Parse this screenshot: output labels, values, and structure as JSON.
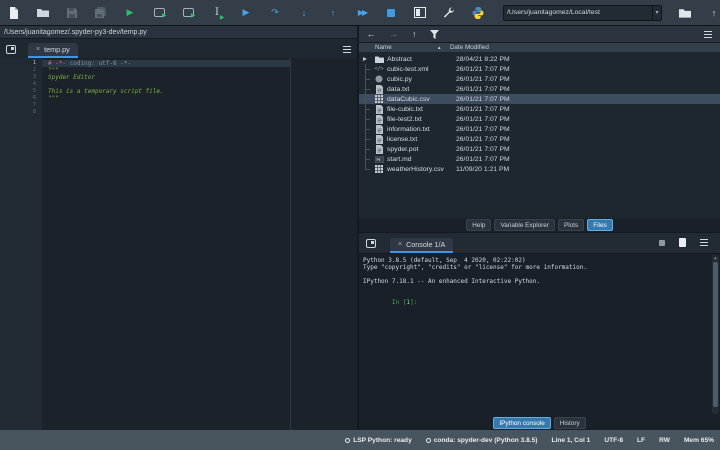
{
  "icons": {
    "run": "▶",
    "debug": "▶",
    "continue": "▶▶",
    "rerun": "↷",
    "step_into": "↓",
    "step_out": "↑",
    "back": "←",
    "forward": "→",
    "up": "↑",
    "up_dir": "↑",
    "sort_asc": "▲",
    "close": "×",
    "caret": "▾",
    "scroll_up": "▲",
    "mini_play": "▶"
  },
  "toolbar": {
    "file_actions": [
      "new-file",
      "open-file",
      "save",
      "save-all"
    ],
    "run_actions": [
      "run-file",
      "run-cell",
      "run-cell-advance",
      "run-selection"
    ],
    "debug_actions": [
      "debug-file",
      "rerun-cell",
      "step-into",
      "step-out",
      "continue",
      "stop"
    ],
    "tools": [
      "maximize-pane",
      "preferences",
      "python-path-manager"
    ],
    "cwd": "/Users/juanitagomez/Local/test"
  },
  "editor": {
    "breadcrumb": "/Users/juanitagomez/.spyder-py3-dev/temp.py",
    "tab_label": "temp.py",
    "lines": [
      {
        "n": "1",
        "text": "# -*- coding: utf-8 -*-",
        "type": "comment",
        "current": true
      },
      {
        "n": "2",
        "text": "\"\"\"",
        "type": "docstring",
        "current": false
      },
      {
        "n": "3",
        "text": "Spyder Editor",
        "type": "docstring",
        "current": false
      },
      {
        "n": "4",
        "text": "",
        "type": "blank",
        "current": false
      },
      {
        "n": "5",
        "text": "This is a temporary script file.",
        "type": "docstring",
        "current": false
      },
      {
        "n": "6",
        "text": "\"\"\"",
        "type": "docstring",
        "current": false
      },
      {
        "n": "7",
        "text": "",
        "type": "blank",
        "current": false
      },
      {
        "n": "8",
        "text": "",
        "type": "blank",
        "current": false
      }
    ]
  },
  "files_pane": {
    "columns": {
      "name": "Name",
      "date": "Date Modified"
    },
    "rows": [
      {
        "name": "Abstract",
        "date": "28/04/21 8:22 PM",
        "icon": "folder",
        "expandable": true,
        "selected": false
      },
      {
        "name": "cubic-test.xml",
        "date": "26/01/21 7:07 PM",
        "icon": "xml",
        "expandable": false,
        "selected": false
      },
      {
        "name": "cubic.py",
        "date": "26/01/21 7:07 PM",
        "icon": "python",
        "expandable": false,
        "selected": false
      },
      {
        "name": "data.txt",
        "date": "26/01/21 7:07 PM",
        "icon": "text",
        "expandable": false,
        "selected": false
      },
      {
        "name": "dataCubic.csv",
        "date": "26/01/21 7:07 PM",
        "icon": "table",
        "expandable": false,
        "selected": true
      },
      {
        "name": "file-cubic.txt",
        "date": "26/01/21 7:07 PM",
        "icon": "text",
        "expandable": false,
        "selected": false
      },
      {
        "name": "file-test2.txt",
        "date": "26/01/21 7:07 PM",
        "icon": "text",
        "expandable": false,
        "selected": false
      },
      {
        "name": "information.txt",
        "date": "26/01/21 7:07 PM",
        "icon": "text",
        "expandable": false,
        "selected": false
      },
      {
        "name": "license.txt",
        "date": "26/01/21 7:07 PM",
        "icon": "text",
        "expandable": false,
        "selected": false
      },
      {
        "name": "spyder.pot",
        "date": "26/01/21 7:07 PM",
        "icon": "text",
        "expandable": false,
        "selected": false
      },
      {
        "name": "start.md",
        "date": "26/01/21 7:07 PM",
        "icon": "markdown",
        "expandable": false,
        "selected": false
      },
      {
        "name": "weatherHistory.csv",
        "date": "11/09/20 1:21 PM",
        "icon": "table",
        "expandable": false,
        "selected": false
      }
    ],
    "tabs": [
      {
        "label": "Help",
        "selected": false
      },
      {
        "label": "Variable Explorer",
        "selected": false
      },
      {
        "label": "Plots",
        "selected": false
      },
      {
        "label": "Files",
        "selected": true
      }
    ]
  },
  "console": {
    "tab_label": "Console 1/A",
    "banner": [
      "Python 3.8.5 (default, Sep  4 2020, 02:22:02)",
      "Type \"copyright\", \"credits\" or \"license\" for more information.",
      "",
      "IPython 7.18.1 -- An enhanced Interactive Python.",
      ""
    ],
    "prompt": {
      "pre": "In [",
      "num": "1",
      "post": "]:"
    },
    "tabs": [
      {
        "label": "IPython console",
        "selected": true
      },
      {
        "label": "History",
        "selected": false
      }
    ]
  },
  "statusbar": {
    "lsp": "LSP Python: ready",
    "conda": "conda: spyder-dev (Python 3.8.5)",
    "cursor": "Line 1, Col 1",
    "encoding": "UTF-8",
    "eol": "LF",
    "permissions": "RW",
    "memory": "Mem 65%"
  },
  "colors": {
    "accent_blue": "#3e96e8",
    "run_green": "#2fbd6b",
    "debug_blue": "#4ba1e8",
    "docstring_green": "#7fb347",
    "selected_row": "#3d4c5e",
    "toolbar_bg": "#333e49",
    "statusbar_bg": "#48555f",
    "editor_bg": "#1b2229"
  }
}
